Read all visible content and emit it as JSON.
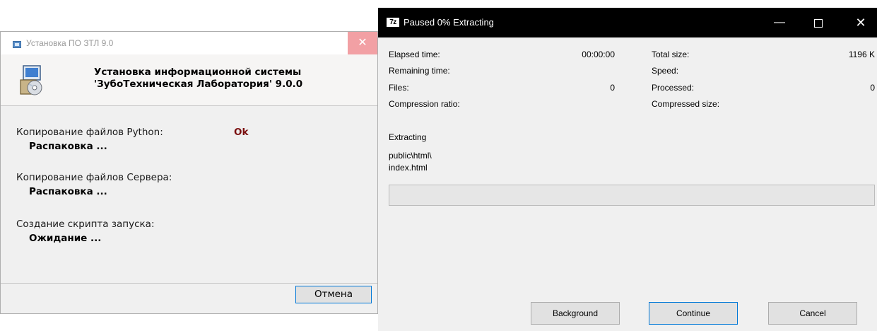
{
  "installer": {
    "title": "Установка ПО ЗТЛ 9.0",
    "close_glyph": "✕",
    "header_line1": "Установка информационной системы",
    "header_line2": "'ЗубоТехническая Лаборатория' 9.0.0",
    "steps": [
      {
        "label": "Копирование файлов Python:",
        "status": "Распаковка ...",
        "result": "Ok"
      },
      {
        "label": "Копирование файлов Сервера:",
        "status": "Распаковка ..."
      },
      {
        "label": "Создание скрипта запуска:",
        "status": "Ожидание ..."
      }
    ],
    "cancel_label": "Отмена",
    "icon": "installer-disk-icon"
  },
  "sevenzip": {
    "title": "Paused 0% Extracting",
    "app_icon_text": "7z",
    "buttons": {
      "minimize": "—",
      "close": "✕"
    },
    "stats_left": [
      {
        "label": "Elapsed time:",
        "value": "00:00:00"
      },
      {
        "label": "Remaining time:",
        "value": ""
      },
      {
        "label": "Files:",
        "value": "0"
      },
      {
        "label": "Compression ratio:",
        "value": ""
      }
    ],
    "stats_right": [
      {
        "label": "Total size:",
        "value": "1196 K"
      },
      {
        "label": "Speed:",
        "value": ""
      },
      {
        "label": "Processed:",
        "value": "0"
      },
      {
        "label": "Compressed size:",
        "value": ""
      }
    ],
    "status": "Extracting",
    "path_line1": "public\\html\\",
    "path_line2": "index.html",
    "progress_fraction": 0,
    "progress_color": "#06b025",
    "background_label": "Background",
    "continue_label": "Continue",
    "cancel_label": "Cancel"
  }
}
